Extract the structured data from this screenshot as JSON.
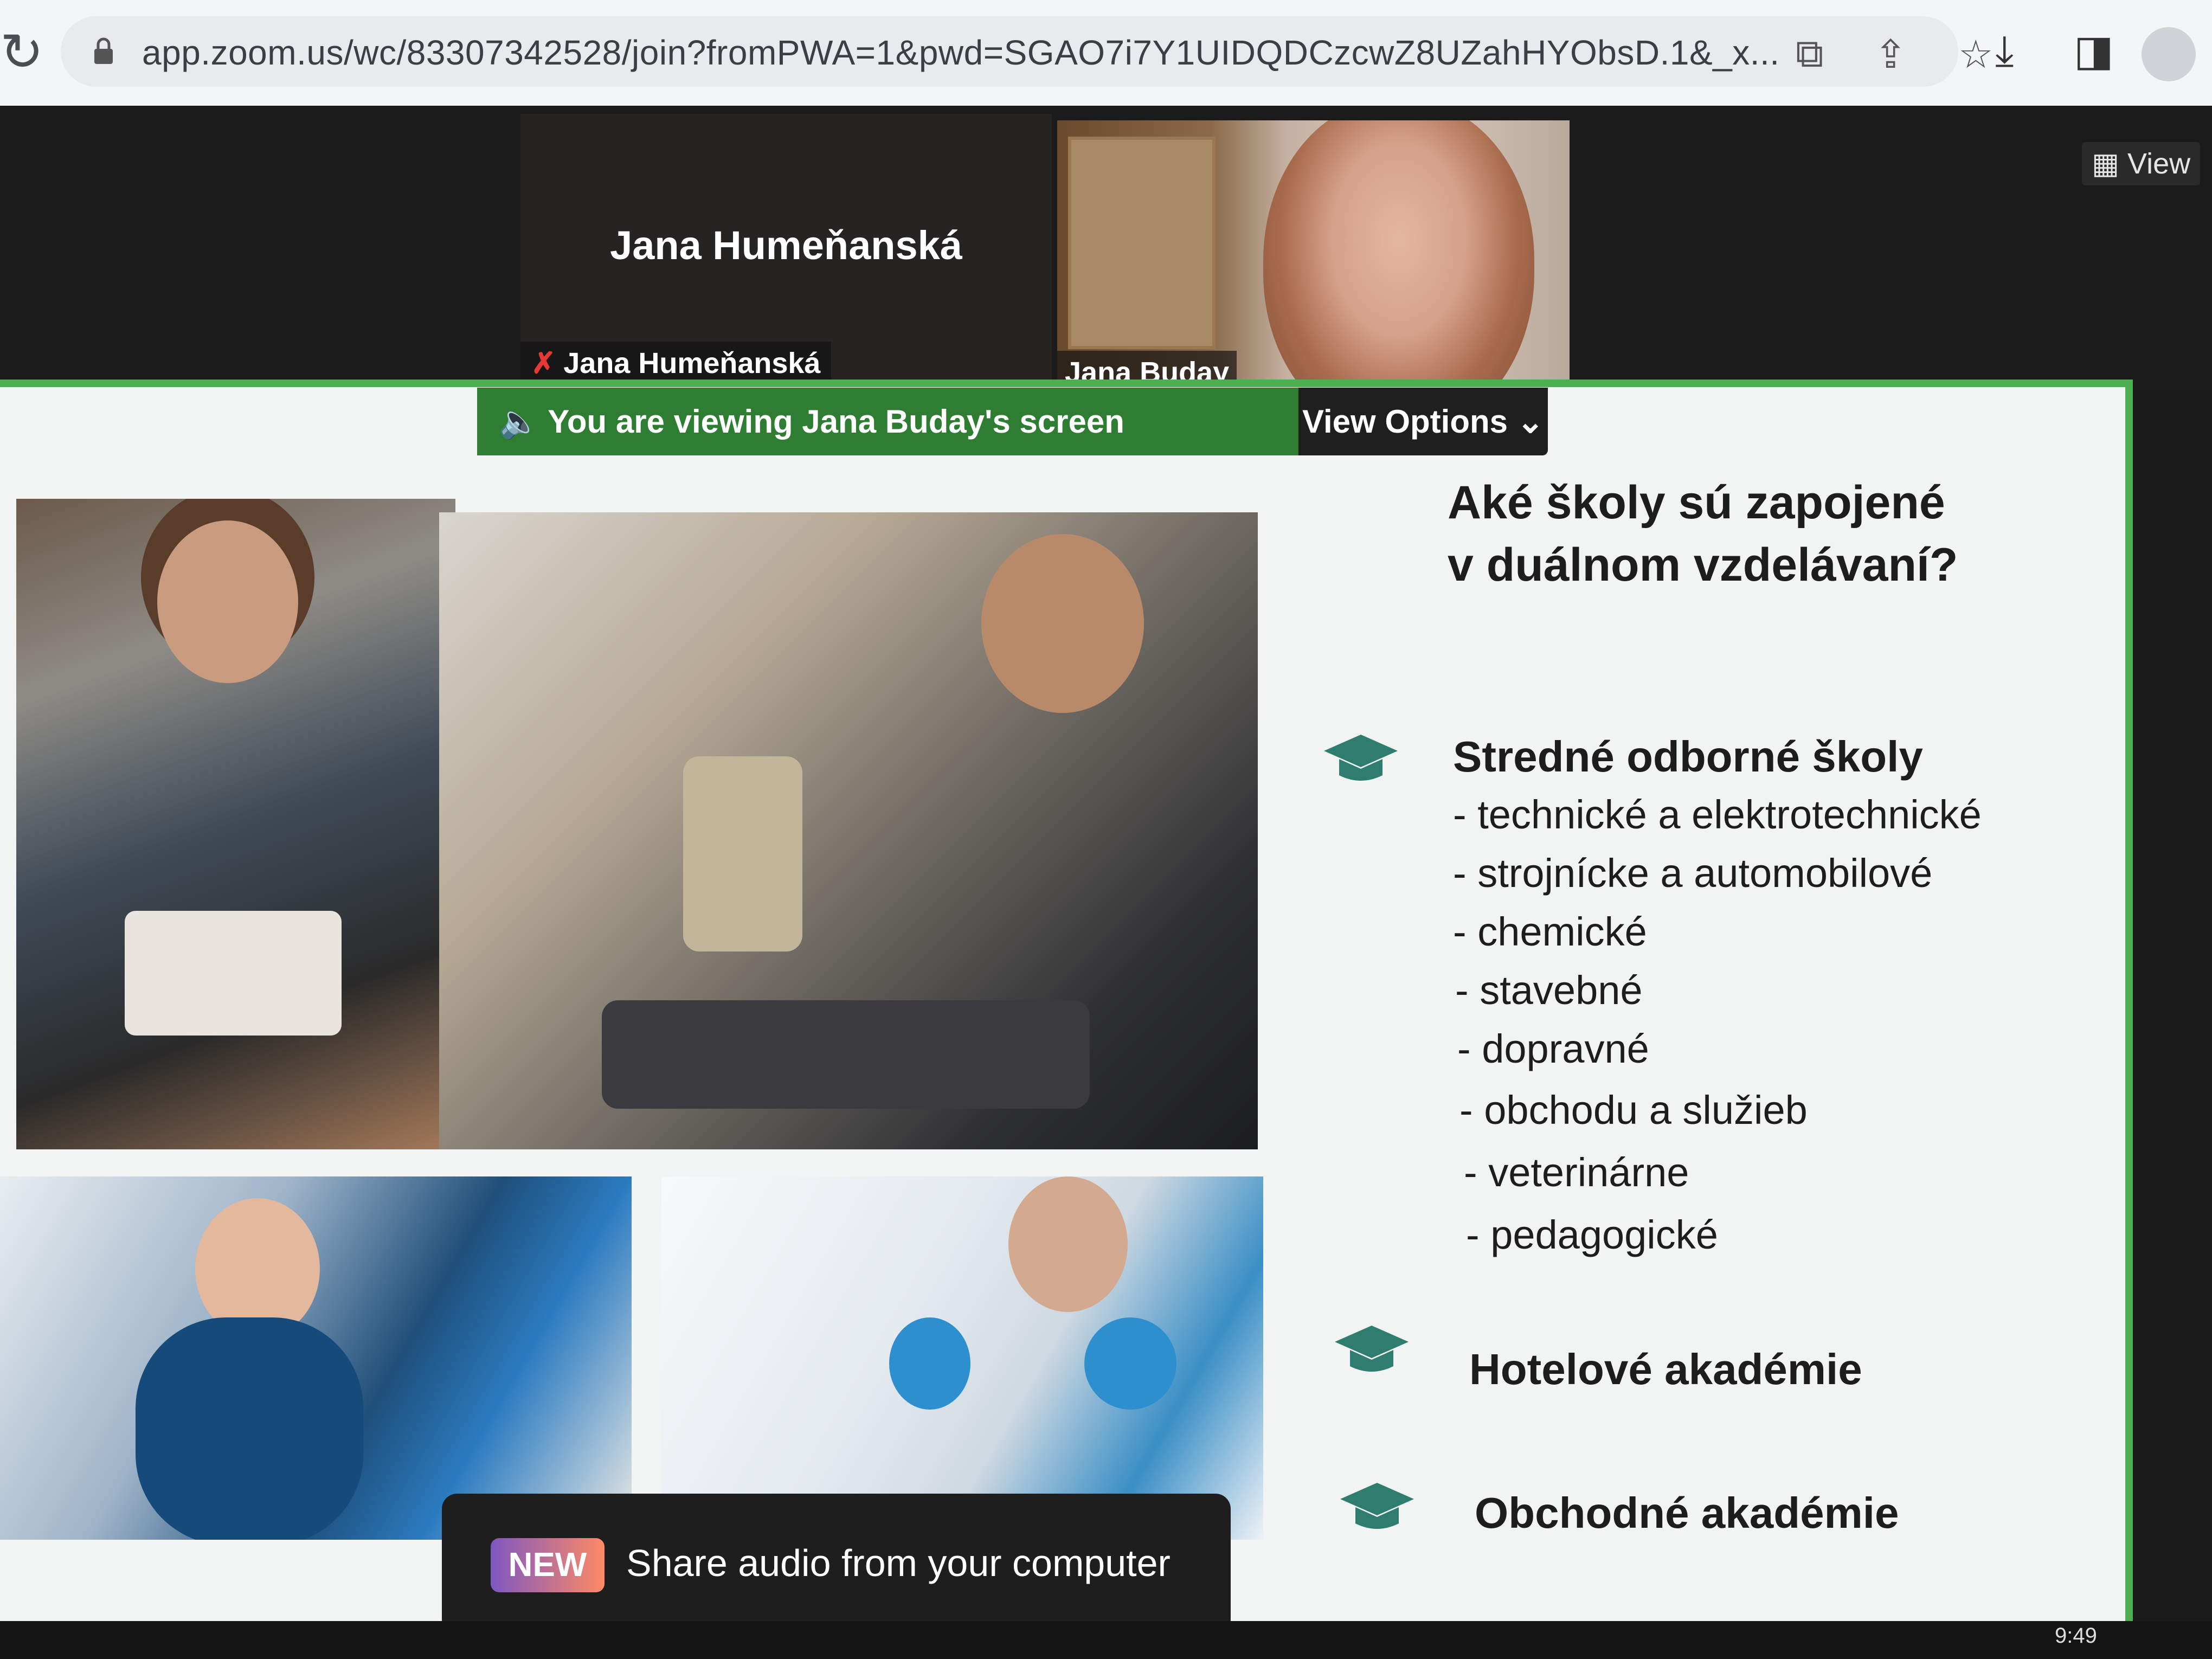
{
  "browser": {
    "url": "app.zoom.us/wc/83307342528/join?fromPWA=1&pwd=SGAO7i7Y1UIDQDCzcwZ8UZahHYObsD.1&_x..."
  },
  "participants": {
    "tile1_name_big": "Jana Humeňanská",
    "tile1_tag": "Jana Humeňanská",
    "tile2_tag": "Jana Buday",
    "view_label": "View"
  },
  "share": {
    "banner_text": "You are viewing  Jana Buday's screen",
    "view_options": "View Options ⌄"
  },
  "slide": {
    "title_line1": "Aké školy sú zapojené",
    "title_line2": "v duálnom vzdelávaní?",
    "section1": "Stredné odborné školy",
    "items": [
      "- technické a elektrotechnické",
      "- strojnícke a automobilové",
      "- chemické",
      "- stavebné",
      "- dopravné",
      "- obchodu a služieb",
      "- veterinárne",
      "- pedagogické"
    ],
    "section2": "Hotelové akadémie",
    "section3": "Obchodné akadémie",
    "accent": "#2e7d6f"
  },
  "toast": {
    "badge": "NEW",
    "message": "Share audio from your computer"
  },
  "system": {
    "clock": "9:49"
  }
}
